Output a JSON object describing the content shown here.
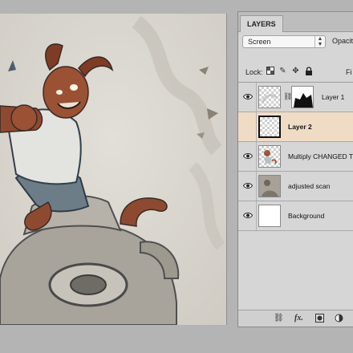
{
  "panel": {
    "tab_label": "LAYERS",
    "blend_mode": "Screen",
    "opacity_label": "Opacity",
    "lock_label": "Lock:",
    "fill_label": "Fi"
  },
  "layers": [
    {
      "name": "Layer 1",
      "visible": true,
      "selected": false,
      "has_mask": true
    },
    {
      "name": "Layer 2",
      "visible": false,
      "selected": true,
      "has_mask": false
    },
    {
      "name": "Multiply CHANGED T",
      "visible": true,
      "selected": false,
      "has_mask": false
    },
    {
      "name": "adjusted scan",
      "visible": true,
      "selected": false,
      "has_mask": false
    },
    {
      "name": "Background",
      "visible": true,
      "selected": false,
      "has_mask": false
    }
  ],
  "bottom_bar": {
    "fx_label": "fx."
  },
  "colors": {
    "selected_row": "#f0dcc5",
    "panel_bg": "#d6d6d6",
    "workspace_bg": "#b4b4b4"
  },
  "icons": {
    "blend_stepper": "chevron-updown-icon",
    "lock_transparency": "checkerboard-icon",
    "lock_paint": "brush-icon",
    "lock_move": "move-icon",
    "lock_all": "padlock-icon",
    "visibility": "eye-icon",
    "link_layers": "link-icon",
    "add_mask": "mask-icon",
    "adjustment": "half-circle-icon"
  }
}
